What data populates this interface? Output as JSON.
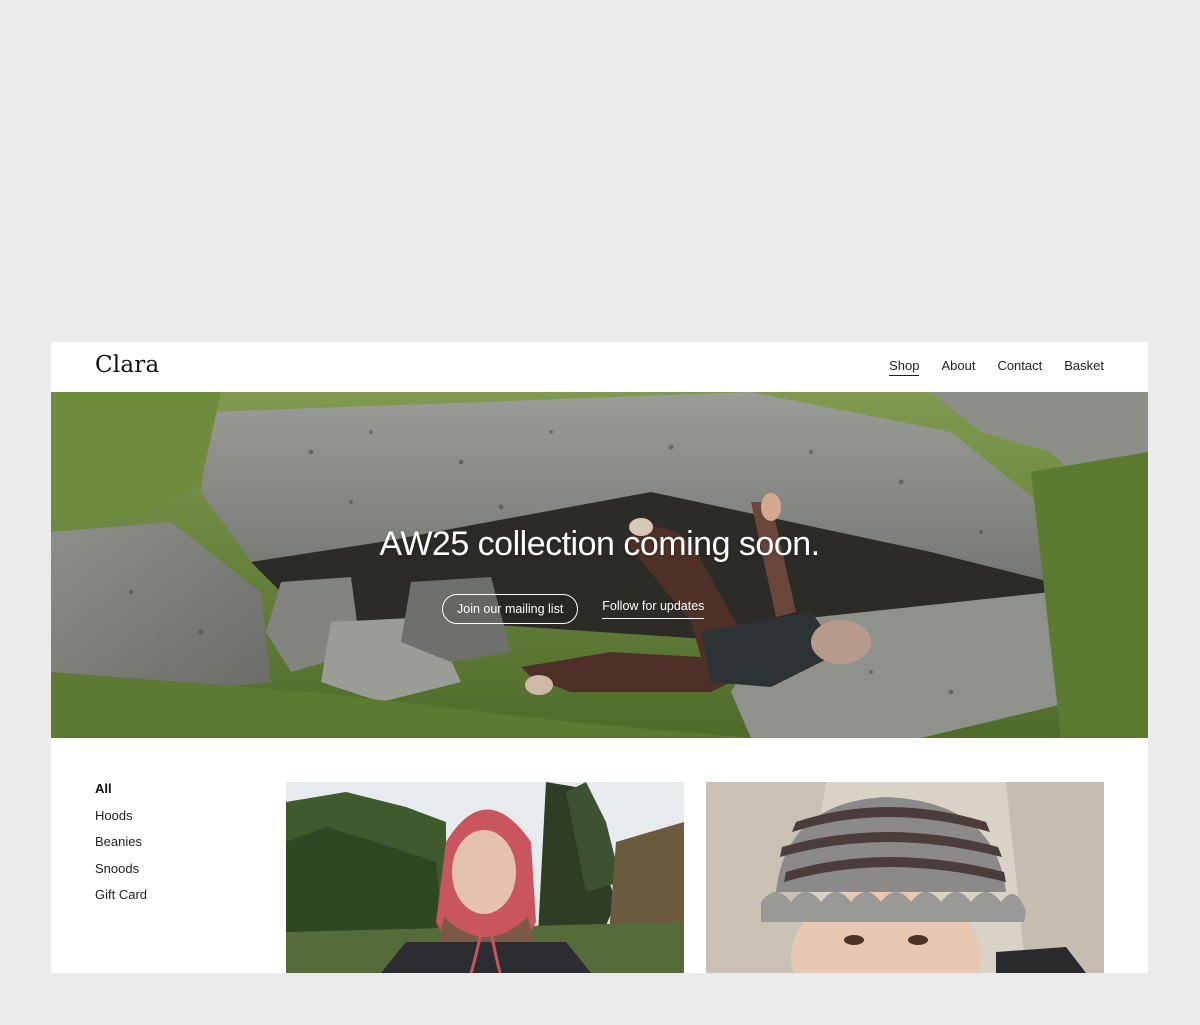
{
  "header": {
    "logo": "Clara",
    "nav": [
      "Shop",
      "About",
      "Contact",
      "Basket"
    ],
    "active_nav": "Shop"
  },
  "hero": {
    "title": "AW25 collection coming soon.",
    "primary_button": "Join our mailing list",
    "secondary_link": "Follow for updates"
  },
  "sidebar": {
    "categories": [
      "All",
      "Hoods",
      "Beanies",
      "Snoods",
      "Gift Card"
    ],
    "active_category": "All"
  },
  "products": [
    {
      "image": "pink-knitted-hood-photo"
    },
    {
      "image": "striped-knitted-bucket-hat-photo"
    }
  ]
}
